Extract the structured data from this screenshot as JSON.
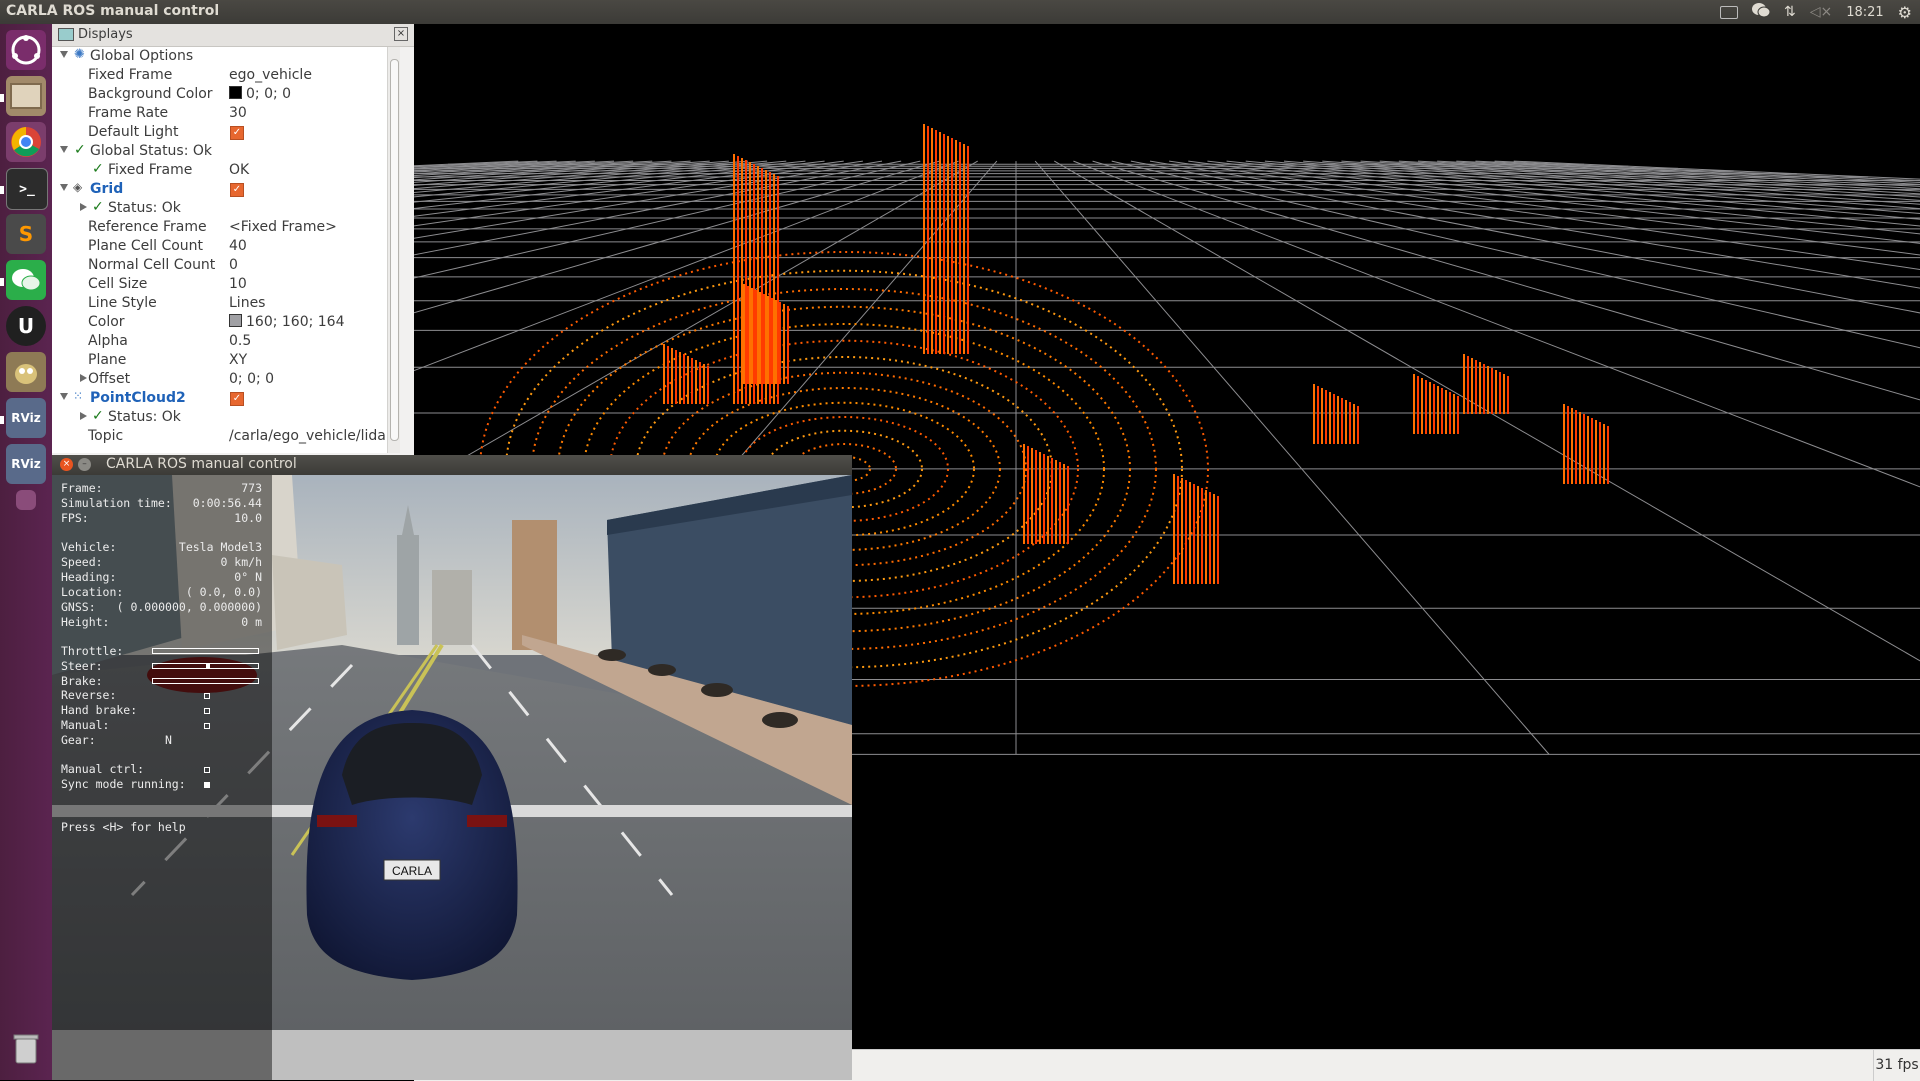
{
  "system_bar": {
    "title": "CARLA ROS manual control",
    "time": "18:21",
    "icons": [
      "keyboard-icon",
      "wechat-icon",
      "network-icon",
      "volume-muted-icon",
      "settings-gear-icon"
    ]
  },
  "launcher": {
    "items": [
      "ubuntu-dash-icon",
      "file-manager-icon",
      "chrome-icon",
      "terminal-icon",
      "sublime-icon",
      "wechat-icon",
      "unreal-engine-icon",
      "gimp-icon",
      "rviz-icon",
      "rviz-icon",
      "workspace-icon",
      "trash-icon"
    ],
    "rviz_label": "RViz",
    "sublime_label": "S"
  },
  "displays": {
    "title": "Displays",
    "rows": [
      {
        "label": "Global Options"
      },
      {
        "label": "Fixed Frame",
        "value": "ego_vehicle"
      },
      {
        "label": "Background Color",
        "value": "0; 0; 0"
      },
      {
        "label": "Frame Rate",
        "value": "30"
      },
      {
        "label": "Default Light"
      },
      {
        "label": "Global Status: Ok"
      },
      {
        "label": "Fixed Frame",
        "value": "OK"
      },
      {
        "label": "Grid"
      },
      {
        "label": "Status: Ok"
      },
      {
        "label": "Reference Frame",
        "value": "<Fixed Frame>"
      },
      {
        "label": "Plane Cell Count",
        "value": "40"
      },
      {
        "label": "Normal Cell Count",
        "value": "0"
      },
      {
        "label": "Cell Size",
        "value": "10"
      },
      {
        "label": "Line Style",
        "value": "Lines"
      },
      {
        "label": "Color",
        "value": "160; 160; 164"
      },
      {
        "label": "Alpha",
        "value": "0.5"
      },
      {
        "label": "Plane",
        "value": "XY"
      },
      {
        "label": "Offset",
        "value": "0; 0; 0"
      },
      {
        "label": "PointCloud2"
      },
      {
        "label": "Status: Ok"
      },
      {
        "label": "Topic",
        "value": "/carla/ego_vehicle/lidar"
      }
    ],
    "colors": {
      "background": "#000000",
      "grid": "#a0a0a4"
    }
  },
  "viewport": {
    "fps": "31 fps"
  },
  "manual_control": {
    "title": "CARLA ROS manual control",
    "hud": {
      "frame_label": "Frame:",
      "frame": "773",
      "sim_label": "Simulation time:",
      "sim": "0:00:56.44",
      "fps_label": "FPS:",
      "fps": "10.0",
      "vehicle_label": "Vehicle:",
      "vehicle": "Tesla Model3",
      "speed_label": "Speed:",
      "speed": "0 km/h",
      "heading_label": "Heading:",
      "heading": "0°  N",
      "location_label": "Location:",
      "location": "(   0.0,    0.0)",
      "gnss_label": "GNSS:",
      "gnss": "( 0.000000,  0.000000)",
      "height_label": "Height:",
      "height": "0 m",
      "throttle_label": "Throttle:",
      "throttle": 0.0,
      "steer_label": "Steer:",
      "steer": 0.0,
      "brake_label": "Brake:",
      "brake": 0.0,
      "reverse_label": "Reverse:",
      "handbrake_label": "Hand brake:",
      "manual_label": "Manual:",
      "gear_label": "Gear:",
      "gear": "N",
      "manual_ctrl_label": "Manual ctrl:",
      "sync_label": "Sync mode running:",
      "sync_mode": true,
      "help": "Press <H> for help"
    },
    "plate": "CARLA"
  }
}
